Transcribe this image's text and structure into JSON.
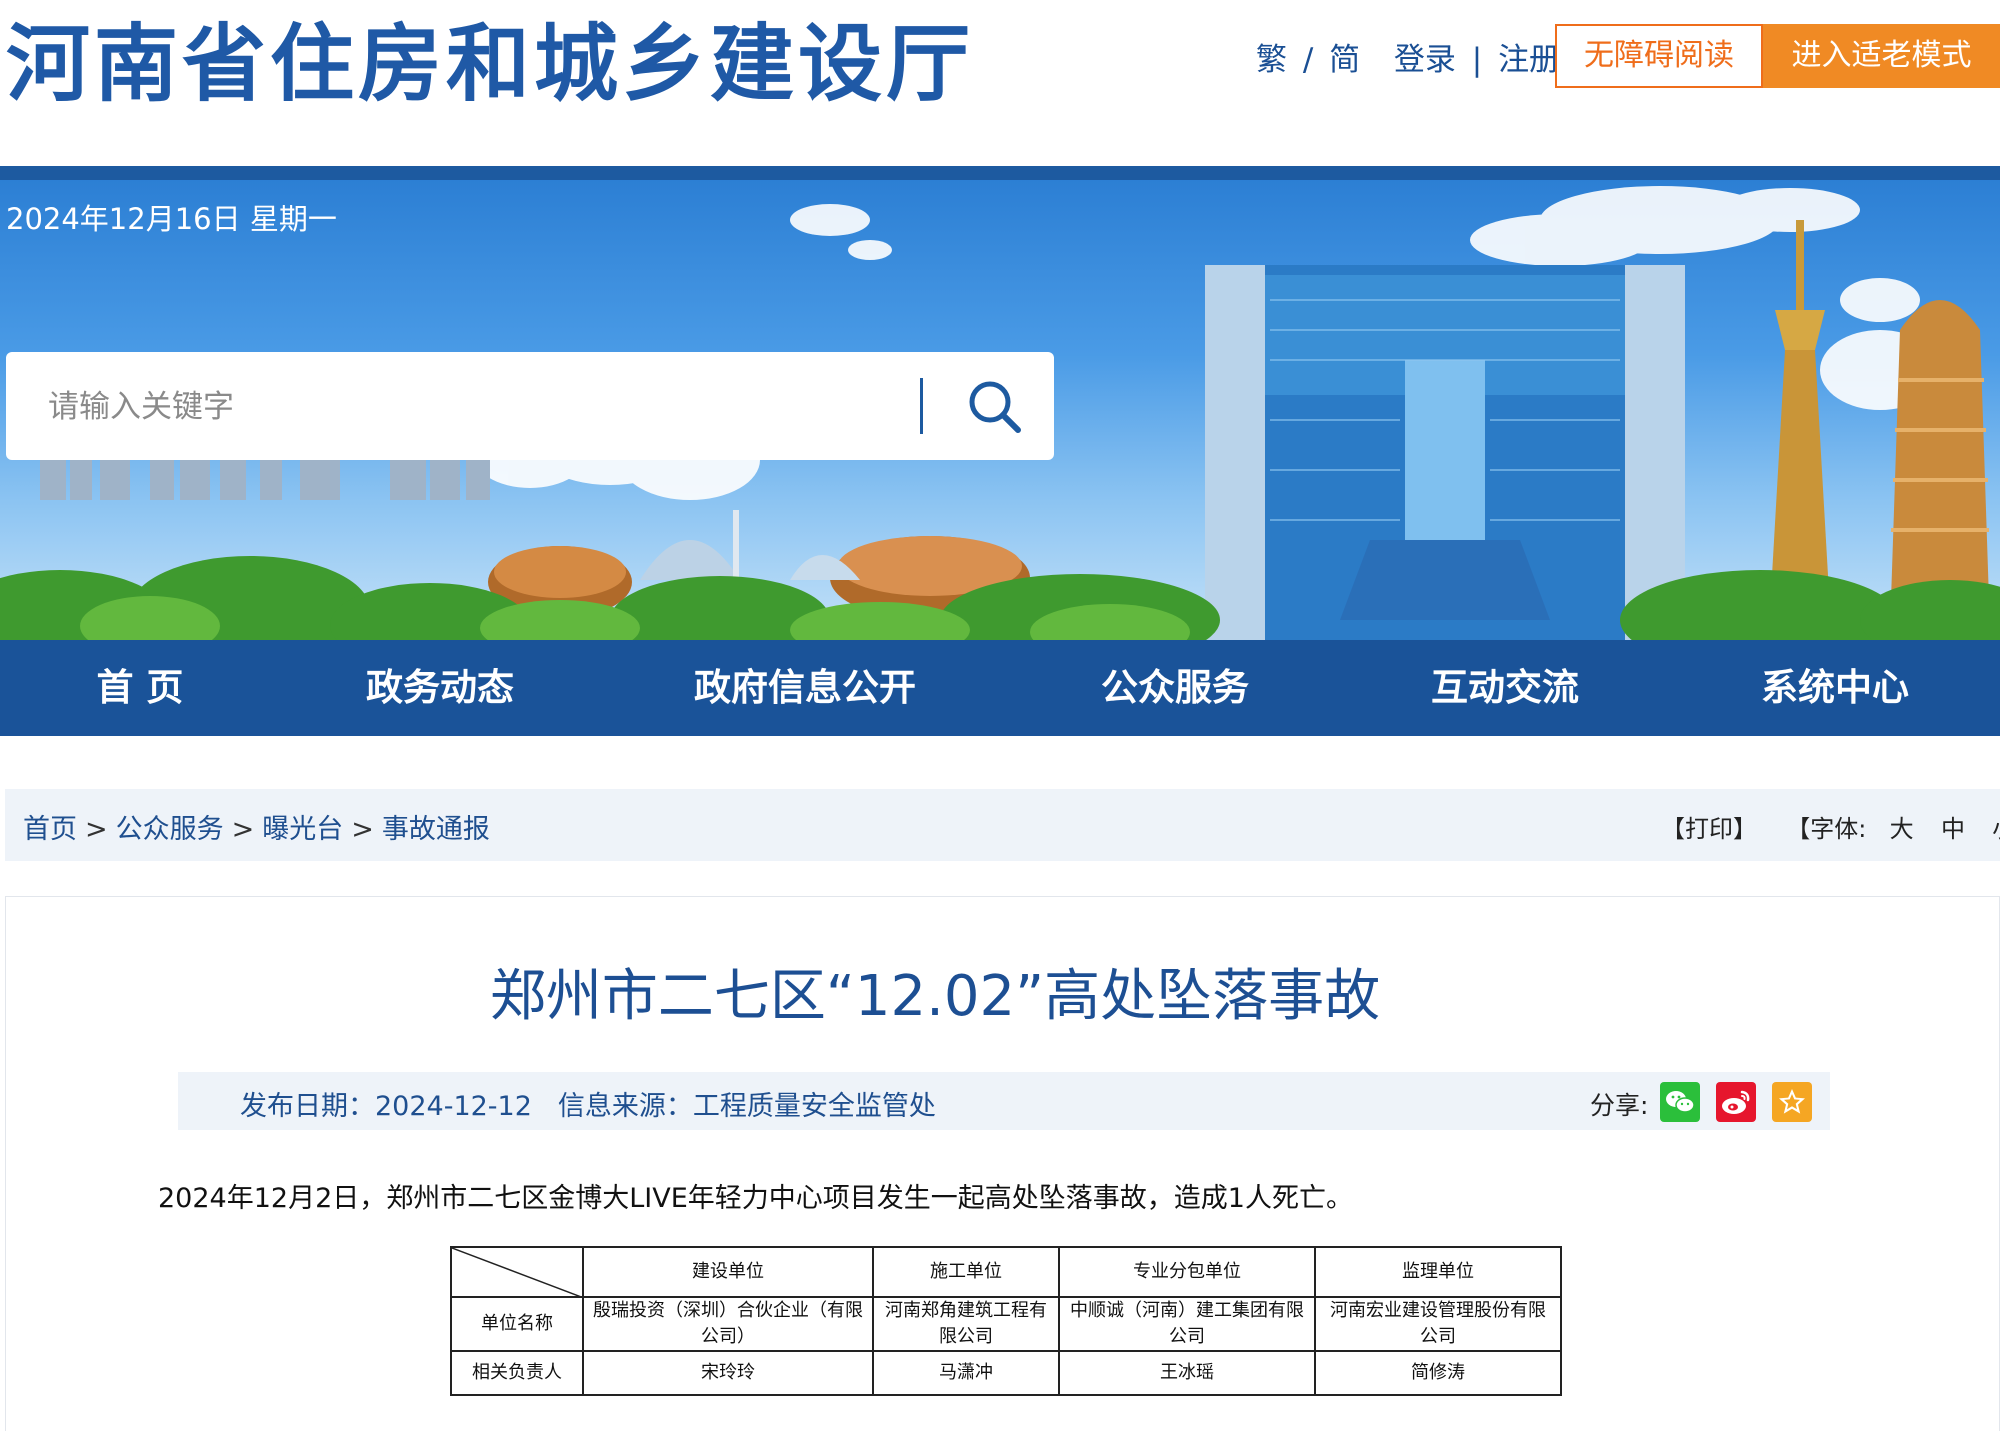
{
  "header": {
    "site_title": "河南省住房和城乡建设厅",
    "lang_traditional": "繁",
    "lang_separator": "/",
    "lang_simplified": "简",
    "login": "登录",
    "link_separator": "|",
    "register": "注册",
    "accessibility_button": "无障碍阅读",
    "elder_mode_button": "进入适老模式"
  },
  "banner": {
    "date": "2024年12月16日 星期一",
    "search_placeholder": "请输入关键字"
  },
  "nav": {
    "items": [
      "首 页",
      "政务动态",
      "政府信息公开",
      "公众服务",
      "互动交流",
      "系统中心"
    ]
  },
  "breadcrumb": {
    "items": [
      "首页",
      "公众服务",
      "曝光台",
      "事故通报"
    ],
    "separator": ">",
    "print": "【打印】",
    "font_prefix": "【字体:",
    "font_large": "大",
    "font_medium": "中",
    "font_small": "小",
    "font_suffix": "】"
  },
  "article": {
    "title": "郑州市二七区“12.02”高处坠落事故",
    "publish_label": "发布日期：",
    "publish_date": "2024-12-12",
    "source_label": "信息来源：",
    "source": "工程质量安全监管处",
    "share_label": "分享:",
    "body": "2024年12月2日，郑州市二七区金博大LIVE年轻力中心项目发生一起高处坠落事故，造成1人死亡。"
  },
  "table": {
    "headers": [
      "建设单位",
      "施工单位",
      "专业分包单位",
      "监理单位"
    ],
    "row_labels": [
      "单位名称",
      "相关负责人"
    ],
    "company_names": [
      "殷瑞投资（深圳）合伙企业（有限公司）",
      "河南郑角建筑工程有限公司",
      "中顺诚（河南）建工集团有限公司",
      "河南宏业建设管理股份有限公司"
    ],
    "responsible_persons": [
      "宋玲玲",
      "马潇冲",
      "王冰瑶",
      "简修涛"
    ]
  },
  "colors": {
    "brand_blue": "#1d5aa0",
    "nav_blue": "#1a5399",
    "title_blue": "#1d4f93",
    "accent_orange": "#f08a24",
    "wechat_green": "#2bbf3b",
    "weibo_red": "#e6162d",
    "favorite_yellow": "#f5a623"
  },
  "icons": {
    "search": "search-icon",
    "wechat": "wechat-icon",
    "weibo": "weibo-icon",
    "favorite": "star-icon"
  }
}
